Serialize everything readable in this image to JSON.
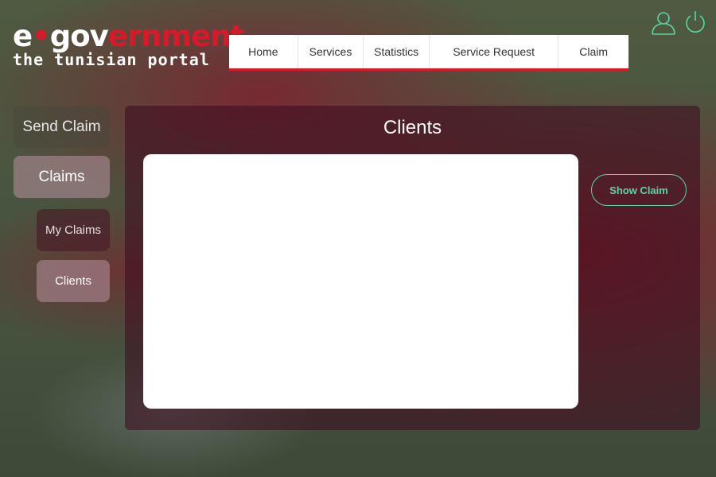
{
  "logo": {
    "line1_prefix": "e",
    "line1_dot": "•",
    "line1_white": "gov",
    "line1_red": "ernment",
    "line2": "the tunisian portal"
  },
  "topnav": {
    "items": [
      {
        "label": "Home"
      },
      {
        "label": "Services"
      },
      {
        "label": "Statistics"
      },
      {
        "label": "Service Request"
      },
      {
        "label": "Claim"
      }
    ]
  },
  "header_icons": {
    "user": "user-icon",
    "power": "power-icon",
    "color": "#5ad6a6"
  },
  "sidebar": {
    "send_claim": "Send Claim",
    "claims": "Claims",
    "my_claims": "My Claims",
    "clients": "Clients"
  },
  "main": {
    "title": "Clients",
    "show_claim": "Show Claim"
  },
  "colors": {
    "accent_red": "#d7192a",
    "accent_green": "#5ad6a6"
  }
}
